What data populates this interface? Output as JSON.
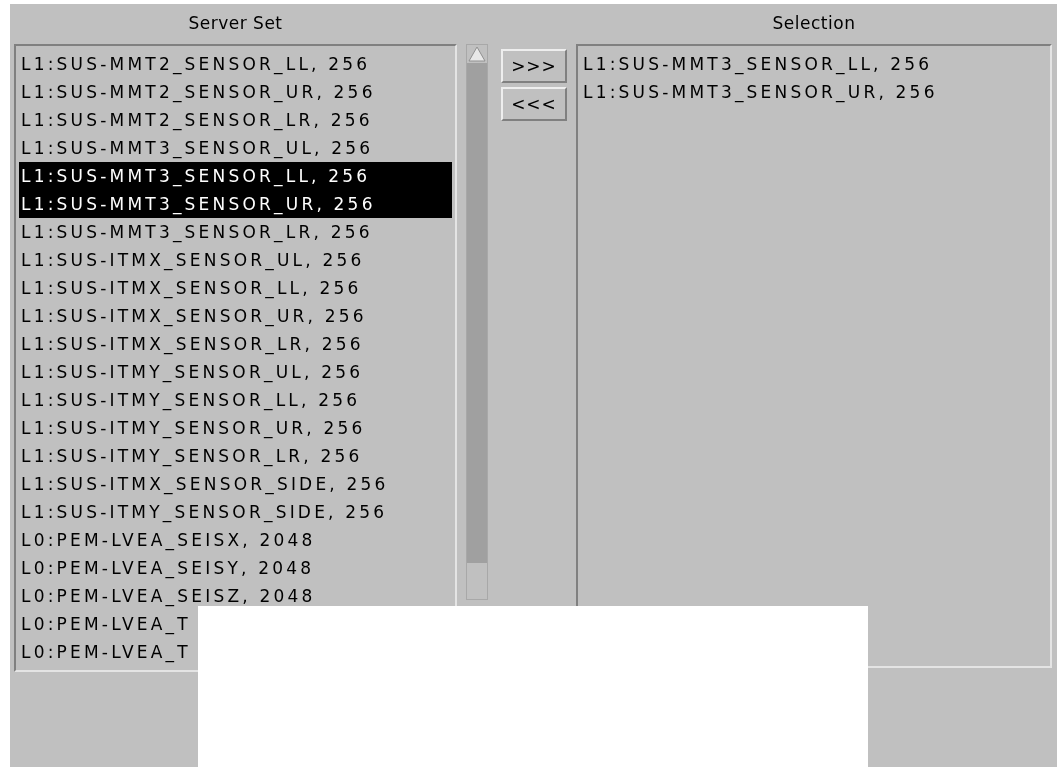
{
  "server_set": {
    "title": "Server Set",
    "items": [
      {
        "label": "L1:SUS-MMT2_SENSOR_LL, 256",
        "selected": false
      },
      {
        "label": "L1:SUS-MMT2_SENSOR_UR, 256",
        "selected": false
      },
      {
        "label": "L1:SUS-MMT2_SENSOR_LR, 256",
        "selected": false
      },
      {
        "label": "L1:SUS-MMT3_SENSOR_UL, 256",
        "selected": false
      },
      {
        "label": "L1:SUS-MMT3_SENSOR_LL, 256",
        "selected": true
      },
      {
        "label": "L1:SUS-MMT3_SENSOR_UR, 256",
        "selected": true
      },
      {
        "label": "L1:SUS-MMT3_SENSOR_LR, 256",
        "selected": false
      },
      {
        "label": "L1:SUS-ITMX_SENSOR_UL, 256",
        "selected": false
      },
      {
        "label": "L1:SUS-ITMX_SENSOR_LL, 256",
        "selected": false
      },
      {
        "label": "L1:SUS-ITMX_SENSOR_UR, 256",
        "selected": false
      },
      {
        "label": "L1:SUS-ITMX_SENSOR_LR, 256",
        "selected": false
      },
      {
        "label": "L1:SUS-ITMY_SENSOR_UL, 256",
        "selected": false
      },
      {
        "label": "L1:SUS-ITMY_SENSOR_LL, 256",
        "selected": false
      },
      {
        "label": "L1:SUS-ITMY_SENSOR_UR, 256",
        "selected": false
      },
      {
        "label": "L1:SUS-ITMY_SENSOR_LR, 256",
        "selected": false
      },
      {
        "label": "L1:SUS-ITMX_SENSOR_SIDE, 256",
        "selected": false
      },
      {
        "label": "L1:SUS-ITMY_SENSOR_SIDE, 256",
        "selected": false
      },
      {
        "label": "L0:PEM-LVEA_SEISX, 2048",
        "selected": false
      },
      {
        "label": "L0:PEM-LVEA_SEISY, 2048",
        "selected": false
      },
      {
        "label": "L0:PEM-LVEA_SEISZ, 2048",
        "selected": false
      },
      {
        "label": "L0:PEM-LVEA_T",
        "selected": false
      },
      {
        "label": "L0:PEM-LVEA_T",
        "selected": false
      }
    ]
  },
  "buttons": [
    ">>>",
    "<<<"
  ],
  "selection": {
    "title": "Selection",
    "items": [
      {
        "label": "L1:SUS-MMT3_SENSOR_LL, 256"
      },
      {
        "label": "L1:SUS-MMT3_SENSOR_UR, 256"
      }
    ]
  }
}
